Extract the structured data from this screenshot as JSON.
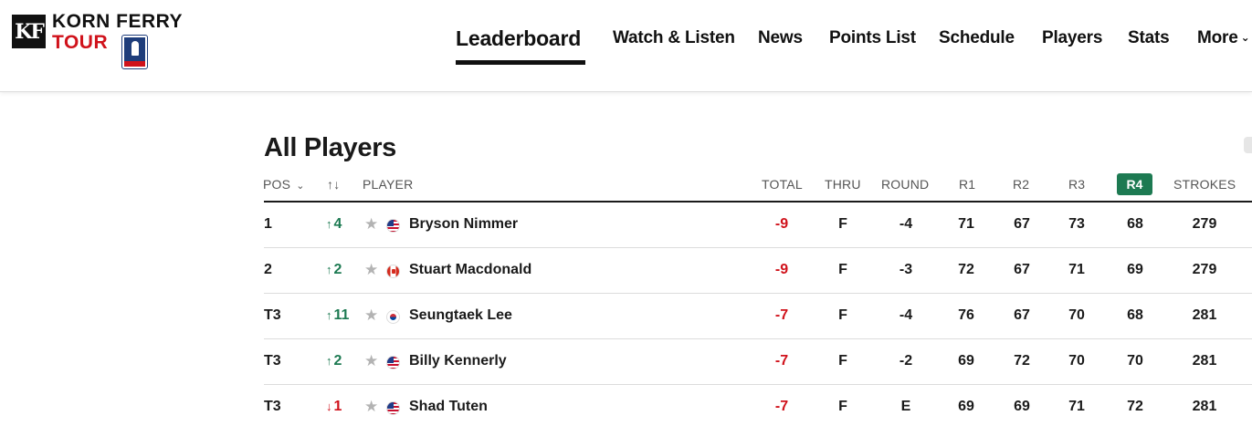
{
  "brand": {
    "name_line1": "KORN FERRY",
    "name_line2": "TOUR",
    "mark": "KF"
  },
  "nav": {
    "items": [
      {
        "label": "Leaderboard",
        "active": true
      },
      {
        "label": "Watch & Listen"
      },
      {
        "label": "News"
      },
      {
        "label": "Points List"
      },
      {
        "label": "Schedule"
      },
      {
        "label": "Players"
      },
      {
        "label": "Stats"
      },
      {
        "label": "More"
      }
    ]
  },
  "leaderboard": {
    "title": "All Players",
    "columns": {
      "pos": "POS",
      "movement": "↑↓",
      "player": "PLAYER",
      "total": "TOTAL",
      "thru": "THRU",
      "round": "ROUND",
      "r1": "R1",
      "r2": "R2",
      "r3": "R3",
      "r4": "R4",
      "strokes": "STROKES"
    },
    "rows": [
      {
        "pos": "1",
        "move_dir": "up",
        "move_arrow": "↑",
        "move_num": "4",
        "flag": "us",
        "player": "Bryson Nimmer",
        "total": "-9",
        "thru": "F",
        "round": "-4",
        "r1": "71",
        "r2": "67",
        "r3": "73",
        "r4": "68",
        "strokes": "279"
      },
      {
        "pos": "2",
        "move_dir": "up",
        "move_arrow": "↑",
        "move_num": "2",
        "flag": "ca",
        "player": "Stuart Macdonald",
        "total": "-9",
        "thru": "F",
        "round": "-3",
        "r1": "72",
        "r2": "67",
        "r3": "71",
        "r4": "69",
        "strokes": "279"
      },
      {
        "pos": "T3",
        "move_dir": "up",
        "move_arrow": "↑",
        "move_num": "11",
        "flag": "kr",
        "player": "Seungtaek Lee",
        "total": "-7",
        "thru": "F",
        "round": "-4",
        "r1": "76",
        "r2": "67",
        "r3": "70",
        "r4": "68",
        "strokes": "281"
      },
      {
        "pos": "T3",
        "move_dir": "up",
        "move_arrow": "↑",
        "move_num": "2",
        "flag": "us",
        "player": "Billy Kennerly",
        "total": "-7",
        "thru": "F",
        "round": "-2",
        "r1": "69",
        "r2": "72",
        "r3": "70",
        "r4": "70",
        "strokes": "281"
      },
      {
        "pos": "T3",
        "move_dir": "down",
        "move_arrow": "↓",
        "move_num": "1",
        "flag": "us",
        "player": "Shad Tuten",
        "total": "-7",
        "thru": "F",
        "round": "E",
        "r1": "69",
        "r2": "69",
        "r3": "71",
        "r4": "72",
        "strokes": "281"
      }
    ]
  },
  "icons": {
    "sort": "chevron-down-icon",
    "favorite": "star-icon",
    "flags": "flag-icon"
  },
  "colors": {
    "accent_green": "#1d7a52",
    "negative_red": "#d0121b",
    "brand_red": "#d0121b"
  }
}
